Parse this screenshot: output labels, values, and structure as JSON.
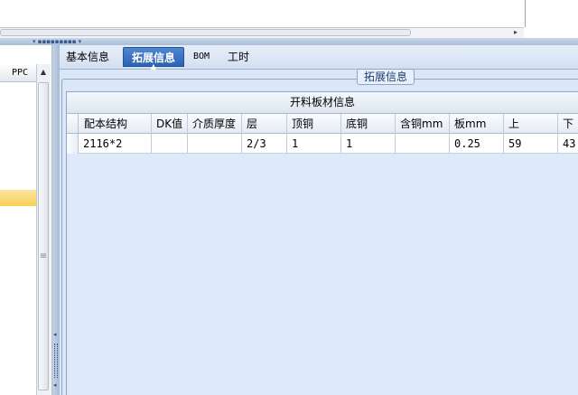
{
  "left_panel": {
    "column_header": "PPC",
    "scroll_up_glyph": "▲",
    "grip_glyph": "≡"
  },
  "scrollbar": {
    "arrow_glyph": "▸"
  },
  "splitter": {
    "grip_glyph": "▾ ▪▪▪▪▪▪▪▪▪ ▾",
    "arrow_glyph": "◂"
  },
  "tabs": [
    {
      "label": "基本信息",
      "active": false
    },
    {
      "label": "拓展信息",
      "active": true
    },
    {
      "label": "BOM",
      "active": false
    },
    {
      "label": "工时",
      "active": false
    }
  ],
  "tab_pointer_glyph": "▲",
  "groupbox": {
    "title": "拓展信息"
  },
  "grid": {
    "caption": "开料板材信息",
    "columns": [
      "配本结构",
      "DK值",
      "介质厚度",
      "层",
      "顶铜",
      "底铜",
      "含铜mm",
      "板mm",
      "上",
      "下"
    ],
    "rows": [
      [
        "2116*2",
        "",
        "",
        "2/3",
        "1",
        "1",
        "",
        "0.25",
        "59",
        "43"
      ]
    ]
  },
  "colors": {
    "active_tab": "#2c62b2",
    "pane_background": "#dbe7f7",
    "selected_row": "#f7cf55"
  }
}
